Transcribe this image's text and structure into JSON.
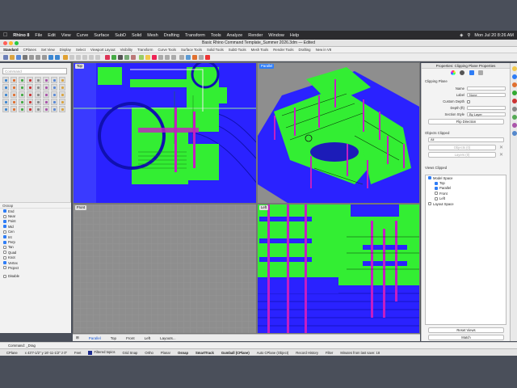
{
  "menubar": {
    "apple_icon": "apple-icon",
    "app_name": "Rhino 8",
    "items": [
      "File",
      "Edit",
      "View",
      "Curve",
      "Surface",
      "SubD",
      "Solid",
      "Mesh",
      "Drafting",
      "Transform",
      "Tools",
      "Analyze",
      "Render",
      "Window",
      "Help"
    ],
    "clock": "Mon Jul 20  8:26 AM"
  },
  "window": {
    "title": "Basic Rhino Command Template_Summer 2026.3dm — Edited"
  },
  "ribbon_tabs": [
    "Standard",
    "CPlanes",
    "Set View",
    "Display",
    "Select",
    "Viewport Layout",
    "Visibility",
    "Transform",
    "Curve Tools",
    "Surface Tools",
    "Solid Tools",
    "SubD Tools",
    "Mesh Tools",
    "Render Tools",
    "Drafting",
    "New in V8"
  ],
  "command": {
    "placeholder": "Command",
    "history": "Command: _Drag"
  },
  "osnap": {
    "header": "Osnap",
    "items": [
      {
        "label": "End",
        "on": true
      },
      {
        "label": "Near",
        "on": false
      },
      {
        "label": "Point",
        "on": true
      },
      {
        "label": "Mid",
        "on": true
      },
      {
        "label": "Cen",
        "on": false
      },
      {
        "label": "Int",
        "on": true
      },
      {
        "label": "Perp",
        "on": true
      },
      {
        "label": "Tan",
        "on": false
      },
      {
        "label": "Quad",
        "on": false
      },
      {
        "label": "Knot",
        "on": false
      },
      {
        "label": "Vertex",
        "on": true
      },
      {
        "label": "Project",
        "on": false
      },
      {
        "label": "Disable",
        "on": false
      }
    ]
  },
  "viewports": {
    "top": {
      "label": "Top"
    },
    "perspective": {
      "label": "Parallel"
    },
    "front": {
      "label": "Front"
    },
    "left": {
      "label": "Left"
    }
  },
  "viewport_tabs": [
    "Parallel",
    "Top",
    "Front",
    "Left",
    "Layouts..."
  ],
  "properties": {
    "title": "Properties: Clipping Plane Properties",
    "section": "Clipping Plane",
    "name_label": "Name",
    "name_value": "",
    "label_label": "Label",
    "label_value": "None",
    "custom_depth_label": "Custom Depth",
    "depth_label": "Depth (ft)",
    "depth_value": "",
    "section_style_label": "Section Style",
    "section_style_value": "By Layer",
    "flip_button": "Flip Direction",
    "objects_clipped": "Objects Clipped",
    "objects_select_value": "All",
    "objects_add_button": "Objects (0)",
    "layers_add_button": "Layers (0)",
    "views_clipped": "Views Clipped",
    "tree": [
      {
        "label": "Model Space",
        "level": 0,
        "on": true
      },
      {
        "label": "Top",
        "level": 1,
        "on": true
      },
      {
        "label": "Parallel",
        "level": 1,
        "on": true
      },
      {
        "label": "Front",
        "level": 1,
        "on": false
      },
      {
        "label": "Left",
        "level": 1,
        "on": false
      },
      {
        "label": "Layout Space",
        "level": 0,
        "on": false
      }
    ],
    "reset_button": "Reset Views",
    "match_button": "Match"
  },
  "statusbar": {
    "cplane": "CPlane",
    "coords": "x 43'7-1/2\"  y 16'-11-1/2\"  z 0\"",
    "units": "Feet",
    "layer": "Filtered topics",
    "items": [
      "Grid Snap",
      "Ortho",
      "Planar",
      "Osnap",
      "SmartTrack",
      "Gumball (CPlane)",
      "Auto CPlane (Object)",
      "Record History",
      "Filter",
      "Minutes from last save: 18"
    ],
    "bold_items": [
      "Osnap",
      "SmartTrack",
      "Gumball (CPlane)"
    ]
  },
  "colors": {
    "model_green": "#33ee33",
    "model_blue": "#2a22ff",
    "accent_magenta": "#c41ec4",
    "viewport_grey": "#8e8e8e"
  }
}
